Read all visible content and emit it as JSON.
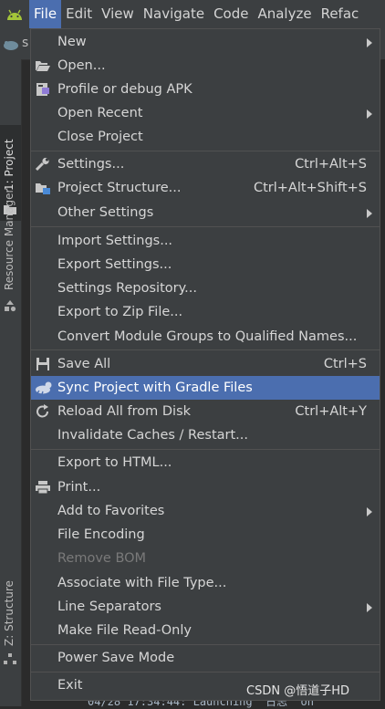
{
  "menubar": {
    "items": [
      {
        "label": "File"
      },
      {
        "label": "Edit"
      },
      {
        "label": "View"
      },
      {
        "label": "Navigate"
      },
      {
        "label": "Code"
      },
      {
        "label": "Analyze"
      },
      {
        "label": "Refac"
      }
    ]
  },
  "toolbar": {
    "project_label": "s"
  },
  "left_strip": {
    "project_tab": "1: Project",
    "resource_tab": "Resource Manager",
    "structure_tab": "Z: Structure"
  },
  "file_menu": {
    "items": [
      {
        "label": "New",
        "shortcut": "",
        "submenu": true
      },
      {
        "label": "Open...",
        "shortcut": "",
        "icon": "folder-open-icon"
      },
      {
        "label": "Profile or debug APK",
        "shortcut": "",
        "icon": "apk-icon"
      },
      {
        "label": "Open Recent",
        "shortcut": "",
        "submenu": true
      },
      {
        "label": "Close Project",
        "shortcut": ""
      },
      {
        "label": "Settings...",
        "shortcut": "Ctrl+Alt+S",
        "icon": "wrench-icon"
      },
      {
        "label": "Project Structure...",
        "shortcut": "Ctrl+Alt+Shift+S",
        "icon": "project-structure-icon"
      },
      {
        "label": "Other Settings",
        "shortcut": "",
        "submenu": true
      },
      {
        "label": "Import Settings...",
        "shortcut": ""
      },
      {
        "label": "Export Settings...",
        "shortcut": ""
      },
      {
        "label": "Settings Repository...",
        "shortcut": ""
      },
      {
        "label": "Export to Zip File...",
        "shortcut": ""
      },
      {
        "label": "Convert Module Groups to Qualified Names...",
        "shortcut": ""
      },
      {
        "label": "Save All",
        "shortcut": "Ctrl+S",
        "icon": "save-icon"
      },
      {
        "label": "Sync Project with Gradle Files",
        "shortcut": "",
        "icon": "gradle-sync-icon",
        "selected": true
      },
      {
        "label": "Reload All from Disk",
        "shortcut": "Ctrl+Alt+Y",
        "icon": "reload-icon"
      },
      {
        "label": "Invalidate Caches / Restart...",
        "shortcut": ""
      },
      {
        "label": "Export to HTML...",
        "shortcut": ""
      },
      {
        "label": "Print...",
        "shortcut": "",
        "icon": "print-icon"
      },
      {
        "label": "Add to Favorites",
        "shortcut": "",
        "submenu": true
      },
      {
        "label": "File Encoding",
        "shortcut": ""
      },
      {
        "label": "Remove BOM",
        "shortcut": "",
        "disabled": true
      },
      {
        "label": "Associate with File Type...",
        "shortcut": ""
      },
      {
        "label": "Line Separators",
        "shortcut": "",
        "submenu": true
      },
      {
        "label": "Make File Read-Only",
        "shortcut": ""
      },
      {
        "label": "Power Save Mode",
        "shortcut": ""
      },
      {
        "label": "Exit",
        "shortcut": ""
      }
    ]
  },
  "background": {
    "log_line": "04/28 17:34:44: Launching '日志' on"
  },
  "watermark": "CSDN @悟道子HD",
  "colors": {
    "menu_bg": "#3c3f41",
    "selection": "#4b6eaf",
    "android_green": "#a4c639"
  }
}
